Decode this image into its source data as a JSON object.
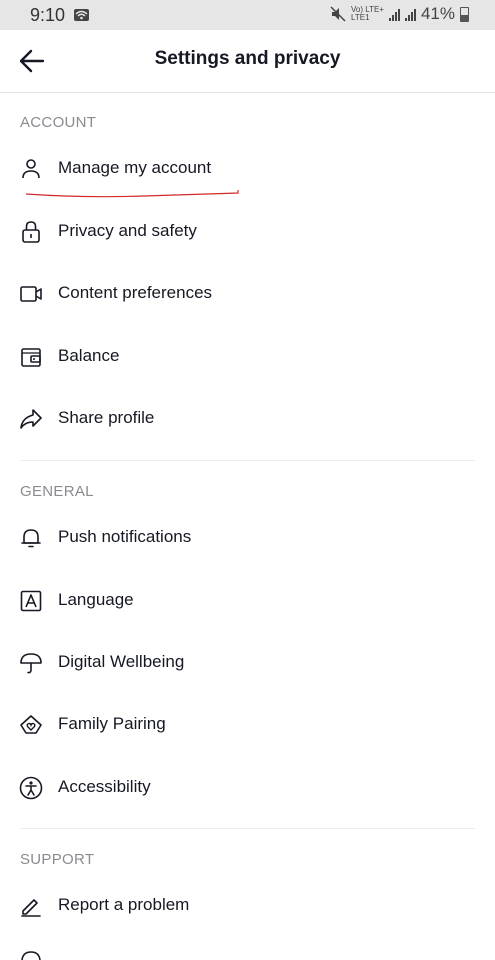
{
  "status_bar": {
    "time": "9:10",
    "network_top": "Vo) LTE+",
    "network_bottom": "LTE1",
    "battery": "41%",
    "battery_level": 0.41
  },
  "header": {
    "title": "Settings and privacy"
  },
  "sections": [
    {
      "title": "ACCOUNT",
      "items": [
        {
          "label": "Manage my account",
          "icon": "person-icon"
        },
        {
          "label": "Privacy and safety",
          "icon": "lock-icon"
        },
        {
          "label": "Content preferences",
          "icon": "video-icon"
        },
        {
          "label": "Balance",
          "icon": "wallet-icon"
        },
        {
          "label": "Share profile",
          "icon": "share-icon"
        }
      ]
    },
    {
      "title": "GENERAL",
      "items": [
        {
          "label": "Push notifications",
          "icon": "bell-icon"
        },
        {
          "label": "Language",
          "icon": "language-icon"
        },
        {
          "label": "Digital Wellbeing",
          "icon": "umbrella-icon"
        },
        {
          "label": "Family Pairing",
          "icon": "family-house-icon"
        },
        {
          "label": "Accessibility",
          "icon": "accessibility-icon"
        }
      ]
    },
    {
      "title": "SUPPORT",
      "items": [
        {
          "label": "Report a problem",
          "icon": "pencil-icon"
        }
      ]
    }
  ],
  "colors": {
    "text": "#161823",
    "section_header": "#8a8b91",
    "annotation": "#d42a2a"
  }
}
